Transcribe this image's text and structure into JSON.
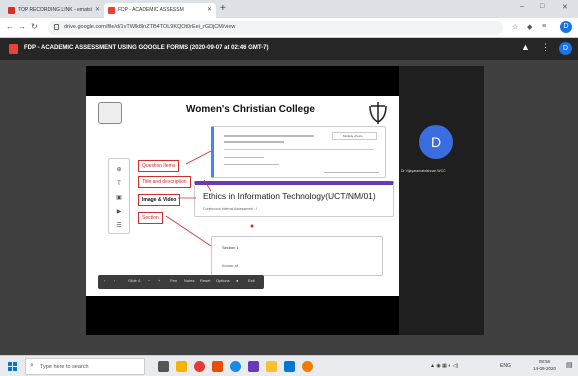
{
  "browser": {
    "tabs": [
      {
        "label": "TOP RECORDING LINK - ematsi",
        "fav_color": "#d93025"
      },
      {
        "label": "FDP - ACADEMIC ASSESSM",
        "fav_color": "#ea4335"
      }
    ],
    "new_tab": "+",
    "url": "drive.google.com/file/d/1vTWlk8lnZTB4TOL9KQOt0rEei_rGDjCM/view",
    "window_controls": [
      "–",
      "□",
      "✕"
    ],
    "profile_initial": "D"
  },
  "drive": {
    "file_title": "FDP - ACADEMIC ASSESSMENT USING GOOGLE FORMS (2020-09-07 at 02:46 GMT-7)",
    "avatar_initial": "D",
    "icons": [
      "drive-icon",
      "more-icon"
    ]
  },
  "slide": {
    "title": "Women's Christian College",
    "form_card_top": {
      "dropdown": "Multiple choice"
    },
    "form_card_mid": {
      "title": "Ethics in Information Technology(UCT/NM/01)",
      "subtitle": "Continuous Internal Assessment - I"
    },
    "form_card_bottom": {
      "title": "Section 1",
      "subtitle": "Answer all"
    },
    "callouts": [
      {
        "label": "Question items",
        "bold": false
      },
      {
        "label": "Title and description",
        "bold": false
      },
      {
        "label": "Image & Video",
        "bold": true
      },
      {
        "label": "Section",
        "bold": false
      }
    ],
    "toolbar_items": [
      "‹",
      "›",
      "Slide 4",
      "−",
      "+",
      "Pen",
      "Notes",
      "Reset",
      "Options",
      "●",
      "Exit"
    ]
  },
  "participant": {
    "initial": "D",
    "name": "Dr Vijayaramakrishnan WCC"
  },
  "taskbar": {
    "search_placeholder": "Type here to search",
    "lang": "ENG",
    "time": "08:56",
    "date": "14-09-2020",
    "apps": [
      {
        "name": "task-view",
        "color": "#555"
      },
      {
        "name": "file-explorer",
        "color": "#f4b400"
      },
      {
        "name": "opera",
        "color": "#e53935"
      },
      {
        "name": "office",
        "color": "#e65100"
      },
      {
        "name": "chrome",
        "color": "#1e88e5"
      },
      {
        "name": "slack",
        "color": "#673ab7"
      },
      {
        "name": "folder",
        "color": "#fbc02d"
      },
      {
        "name": "store",
        "color": "#0078d7"
      },
      {
        "name": "firefox",
        "color": "#f57c00"
      }
    ]
  }
}
